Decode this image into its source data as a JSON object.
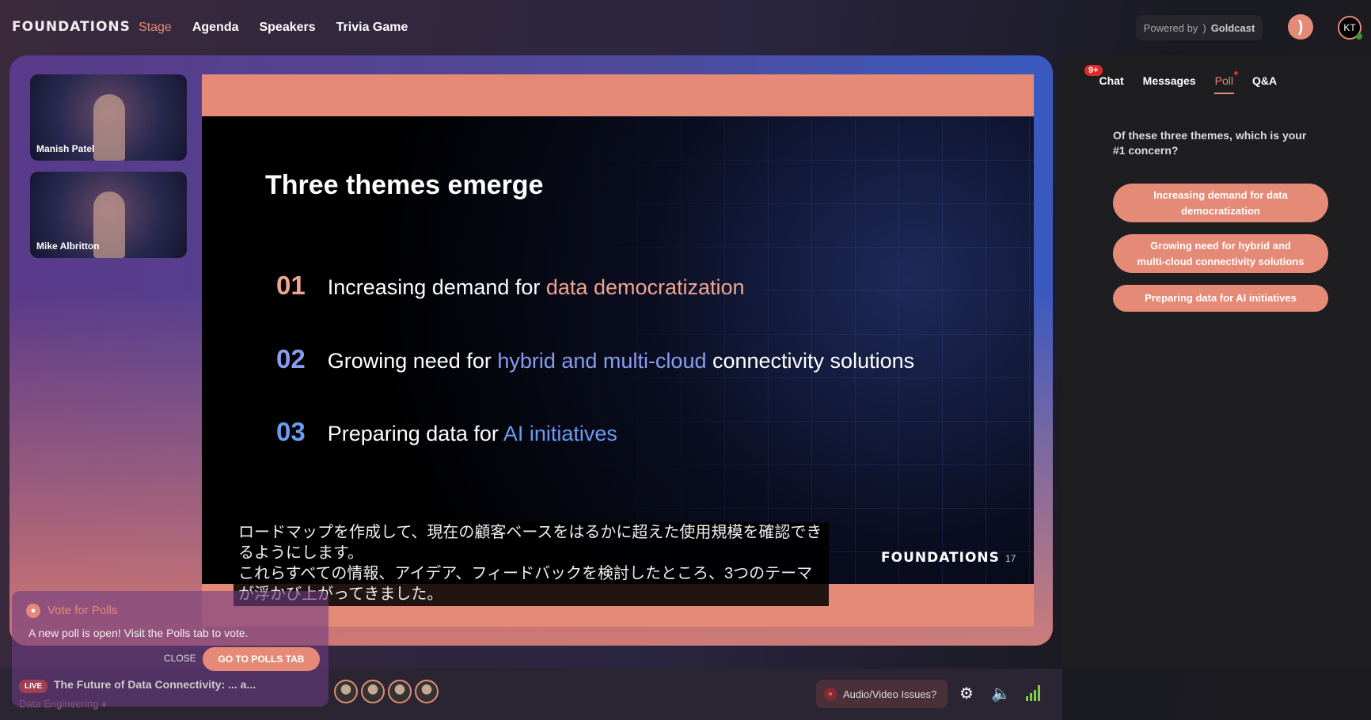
{
  "header": {
    "logo": "FOUNDATIONS",
    "nav": [
      "Stage",
      "Agenda",
      "Speakers",
      "Trivia Game"
    ],
    "active_nav": "Stage",
    "powered_by": "Powered by",
    "brand": "Goldcast",
    "user_initials": "KT"
  },
  "speakers": [
    {
      "name": "Manish Patel"
    },
    {
      "name": "Mike Albritton"
    }
  ],
  "slide": {
    "title": "Three themes emerge",
    "items": [
      {
        "num": "01",
        "pre": "Increasing demand for ",
        "hl": "data democratization",
        "post": "",
        "num_color": "#f0a58f",
        "hl_color": "#f0a58f"
      },
      {
        "num": "02",
        "pre": "Growing need for ",
        "hl": "hybrid and multi-cloud",
        "post": " connectivity solutions",
        "num_color": "#8a9cf0",
        "hl_color": "#8a9cf0"
      },
      {
        "num": "03",
        "pre": "Preparing data for ",
        "hl": "AI initiatives",
        "post": "",
        "num_color": "#6a9cf0",
        "hl_color": "#6a9cf0"
      }
    ],
    "logo": "FOUNDATIONS",
    "page": "17"
  },
  "captions": [
    "ロードマップを作成して、現在の顧客ベースをはるかに超えた使用規模を確認できるようにします。",
    "これらすべての情報、アイデア、フィードバックを検討したところ、3つのテーマが浮かび上がってきました。"
  ],
  "panel": {
    "tabs": [
      "Chat",
      "Messages",
      "Poll",
      "Q&A"
    ],
    "active_tab": "Poll",
    "chat_badge": "9+",
    "poll": {
      "question": "Of these three themes, which is your #1 concern?",
      "options": [
        "Increasing demand for data democratization",
        "Growing need for hybrid and multi-cloud connectivity solutions",
        "Preparing data for AI initiatives"
      ]
    }
  },
  "bottom": {
    "live": "LIVE",
    "event_title": "The Future of Data Connectivity: ... a...",
    "track": "Data Engineering",
    "av_issues": "Audio/Video Issues?"
  },
  "popup": {
    "title": "Vote for Polls",
    "message": "A new poll is open! Visit the Polls tab to vote.",
    "close": "CLOSE",
    "go": "GO TO POLLS TAB"
  },
  "colors": {
    "accent": "#e58a76",
    "panel": "#1e1e21",
    "signal": "#7ad04a"
  }
}
